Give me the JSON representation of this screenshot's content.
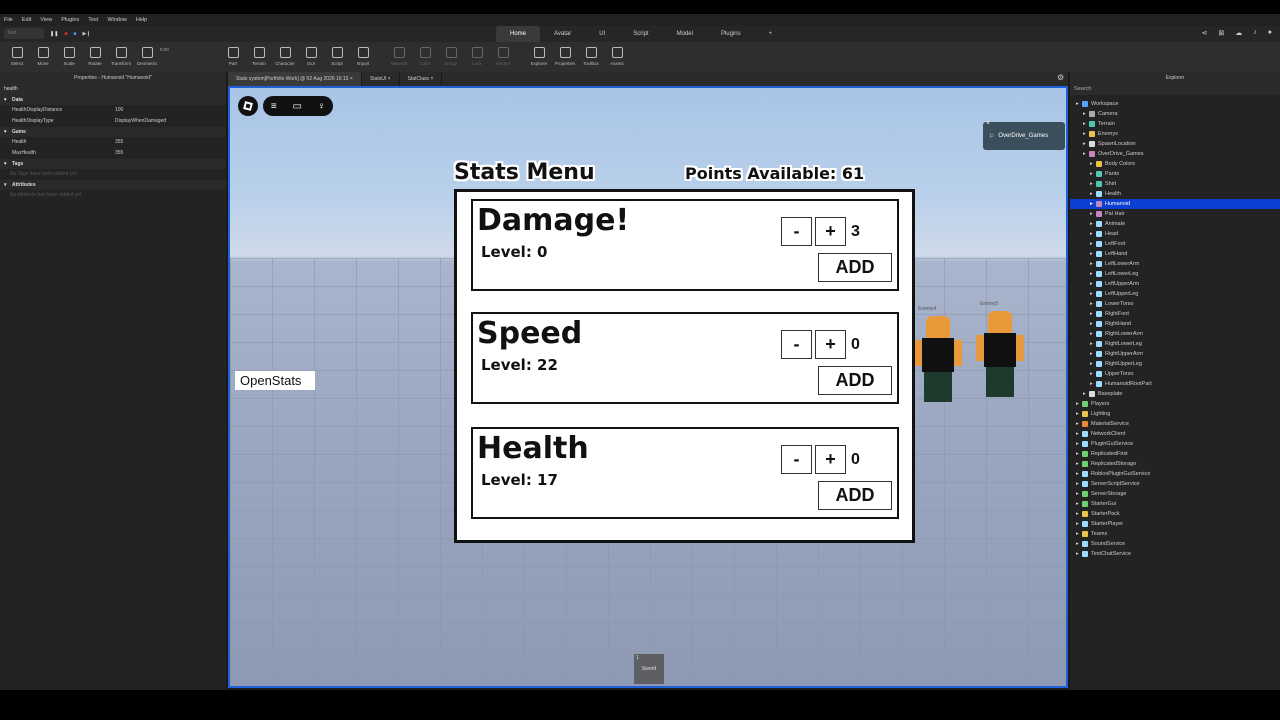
{
  "menubar": [
    "File",
    "Edit",
    "View",
    "Plugins",
    "Test",
    "Window",
    "Help"
  ],
  "run": {
    "mode": "Test"
  },
  "ribbon_tabs": [
    {
      "label": "Home",
      "active": true
    },
    {
      "label": "Avatar",
      "active": false
    },
    {
      "label": "UI",
      "active": false
    },
    {
      "label": "Script",
      "active": false
    },
    {
      "label": "Model",
      "active": false
    },
    {
      "label": "Plugins",
      "active": false
    },
    {
      "label": "+",
      "active": false
    }
  ],
  "toolbar": {
    "tools": [
      "Select",
      "Move",
      "Scale",
      "Rotate",
      "Transform",
      "Geometric"
    ],
    "snap_value": "0.00",
    "insert": [
      "Part",
      "Terrain",
      "Character",
      "GUI",
      "Script",
      "Import"
    ],
    "edit": [
      "Material",
      "Color",
      "Group",
      "Lock",
      "Anchor"
    ],
    "panels": [
      "Explorer",
      "Properties",
      "Toolbox",
      "Assets"
    ]
  },
  "properties": {
    "title": "Properties - Humanoid \"Humanoid\"",
    "search": "health",
    "sections": [
      {
        "name": "Data",
        "rows": [
          {
            "key": "HealthDisplayDistance",
            "value": "100"
          },
          {
            "key": "HealthDisplayType",
            "value": "DisplayWhenDamaged"
          }
        ]
      },
      {
        "name": "Game",
        "rows": [
          {
            "key": "Health",
            "value": "355"
          },
          {
            "key": "MaxHealth",
            "value": "355"
          }
        ]
      }
    ],
    "tags_label": "Tags",
    "tags_empty": "No Tags have been added yet",
    "attributes_label": "Attributes",
    "attributes_empty": "No Attribute has been added yet"
  },
  "doc_tabs": [
    {
      "label": "Stats system[Portfolio Work] @ 02 Aug 2026 16:15",
      "active": true
    },
    {
      "label": "StatsUI",
      "active": false
    },
    {
      "label": "StatClass",
      "active": false
    }
  ],
  "viewport": {
    "badge": "OverDrive_Games",
    "open_stats": "OpenStats",
    "stats_title": "Stats Menu",
    "points_label": "Points Available: 61",
    "stats": [
      {
        "name": "Damage!",
        "level": "Level: 0",
        "minus": "-",
        "plus": "+",
        "count": "3",
        "add": "ADD"
      },
      {
        "name": "Speed",
        "level": "Level: 22",
        "minus": "-",
        "plus": "+",
        "count": "0",
        "add": "ADD"
      },
      {
        "name": "Health",
        "level": "Level: 17",
        "minus": "-",
        "plus": "+",
        "count": "0",
        "add": "ADD"
      }
    ],
    "enemies": [
      "Enemy4",
      "Enemy5"
    ],
    "hotbar": {
      "slot": "1",
      "tool": "Sword"
    }
  },
  "explorer": {
    "title": "Explorer",
    "search": "Search",
    "items": [
      {
        "label": "Workspace",
        "depth": 0,
        "color": "#5aa0ff"
      },
      {
        "label": "Camera",
        "depth": 1,
        "color": "#aaaaaa"
      },
      {
        "label": "Terrain",
        "depth": 1,
        "color": "#4ec9b0"
      },
      {
        "label": "Enemys",
        "depth": 1,
        "color": "#e8c34a"
      },
      {
        "label": "SpawnLocation",
        "depth": 1,
        "color": "#dddddd"
      },
      {
        "label": "OverDrive_Games",
        "depth": 1,
        "color": "#c586c0"
      },
      {
        "label": "Body Colors",
        "depth": 2,
        "color": "#e8c34a"
      },
      {
        "label": "Pants",
        "depth": 2,
        "color": "#4ec9b0"
      },
      {
        "label": "Shirt",
        "depth": 2,
        "color": "#4ec9b0"
      },
      {
        "label": "Health",
        "depth": 2,
        "color": "#9cdcfe"
      },
      {
        "label": "Humanoid",
        "depth": 2,
        "color": "#c586c0",
        "selected": true
      },
      {
        "label": "Pal Hair",
        "depth": 2,
        "color": "#c586c0"
      },
      {
        "label": "Animate",
        "depth": 2,
        "color": "#9cdcfe"
      },
      {
        "label": "Head",
        "depth": 2,
        "color": "#9cdcfe"
      },
      {
        "label": "LeftFoot",
        "depth": 2,
        "color": "#9cdcfe"
      },
      {
        "label": "LeftHand",
        "depth": 2,
        "color": "#9cdcfe"
      },
      {
        "label": "LeftLowerArm",
        "depth": 2,
        "color": "#9cdcfe"
      },
      {
        "label": "LeftLowerLeg",
        "depth": 2,
        "color": "#9cdcfe"
      },
      {
        "label": "LeftUpperArm",
        "depth": 2,
        "color": "#9cdcfe"
      },
      {
        "label": "LeftUpperLeg",
        "depth": 2,
        "color": "#9cdcfe"
      },
      {
        "label": "LowerTorso",
        "depth": 2,
        "color": "#9cdcfe"
      },
      {
        "label": "RightFoot",
        "depth": 2,
        "color": "#9cdcfe"
      },
      {
        "label": "RightHand",
        "depth": 2,
        "color": "#9cdcfe"
      },
      {
        "label": "RightLowerArm",
        "depth": 2,
        "color": "#9cdcfe"
      },
      {
        "label": "RightLowerLeg",
        "depth": 2,
        "color": "#9cdcfe"
      },
      {
        "label": "RightUpperArm",
        "depth": 2,
        "color": "#9cdcfe"
      },
      {
        "label": "RightUpperLeg",
        "depth": 2,
        "color": "#9cdcfe"
      },
      {
        "label": "UpperTorso",
        "depth": 2,
        "color": "#9cdcfe"
      },
      {
        "label": "HumanoidRootPart",
        "depth": 2,
        "color": "#9cdcfe"
      },
      {
        "label": "Baseplate",
        "depth": 1,
        "color": "#dddddd"
      },
      {
        "label": "Players",
        "depth": 0,
        "color": "#6fcf6f"
      },
      {
        "label": "Lighting",
        "depth": 0,
        "color": "#e8c34a"
      },
      {
        "label": "MaterialService",
        "depth": 0,
        "color": "#e88a3a"
      },
      {
        "label": "NetworkClient",
        "depth": 0,
        "color": "#9cdcfe"
      },
      {
        "label": "PluginGuiService",
        "depth": 0,
        "color": "#9cdcfe"
      },
      {
        "label": "ReplicatedFirst",
        "depth": 0,
        "color": "#6fcf6f"
      },
      {
        "label": "ReplicatedStorage",
        "depth": 0,
        "color": "#6fcf6f"
      },
      {
        "label": "RobloxPluginGuiService",
        "depth": 0,
        "color": "#9cdcfe"
      },
      {
        "label": "ServerScriptService",
        "depth": 0,
        "color": "#9cdcfe"
      },
      {
        "label": "ServerStorage",
        "depth": 0,
        "color": "#6fcf6f"
      },
      {
        "label": "StarterGui",
        "depth": 0,
        "color": "#6fcf6f"
      },
      {
        "label": "StarterPack",
        "depth": 0,
        "color": "#e8c34a"
      },
      {
        "label": "StarterPlayer",
        "depth": 0,
        "color": "#9cdcfe"
      },
      {
        "label": "Teams",
        "depth": 0,
        "color": "#e8c34a"
      },
      {
        "label": "SoundService",
        "depth": 0,
        "color": "#9cdcfe"
      },
      {
        "label": "TextChatService",
        "depth": 0,
        "color": "#9cdcfe"
      }
    ]
  },
  "colors": {
    "accent": "#0b3fd1",
    "viewport_border": "#1f5fd8"
  }
}
